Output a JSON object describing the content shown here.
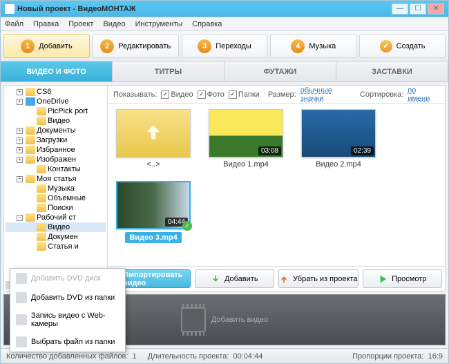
{
  "window": {
    "title": "Новый проект - ВидеоМОНТАЖ"
  },
  "menu": [
    "Файл",
    "Правка",
    "Проект",
    "Видео",
    "Инструменты",
    "Справка"
  ],
  "steps": [
    {
      "num": "1",
      "label": "Добавить"
    },
    {
      "num": "2",
      "label": "Редактировать"
    },
    {
      "num": "3",
      "label": "Переходы"
    },
    {
      "num": "4",
      "label": "Музыка"
    },
    {
      "check": "✓",
      "label": "Создать"
    }
  ],
  "tabs": [
    "ВИДЕО И ФОТО",
    "ТИТРЫ",
    "ФУТАЖИ",
    "ЗАСТАВКИ"
  ],
  "filters": {
    "show_label": "Показывать:",
    "video": "Видео",
    "photo": "Фото",
    "folders": "Папки",
    "size_label": "Размер:",
    "size_value": "обычные значки",
    "sort_label": "Сортировка:",
    "sort_value": "по имени"
  },
  "tree": [
    {
      "l": 1,
      "exp": "+",
      "ic": "folder",
      "t": "CS6"
    },
    {
      "l": 1,
      "exp": "+",
      "ic": "blue",
      "t": "OneDrive"
    },
    {
      "l": 2,
      "ic": "folder",
      "t": "PicPick port"
    },
    {
      "l": 2,
      "ic": "folder",
      "t": "Видео"
    },
    {
      "l": 1,
      "exp": "+",
      "ic": "folder",
      "t": "Документы"
    },
    {
      "l": 1,
      "exp": "+",
      "ic": "folder",
      "t": "Загрузки"
    },
    {
      "l": 1,
      "exp": "+",
      "ic": "folder",
      "t": "Избранное"
    },
    {
      "l": 1,
      "exp": "+",
      "ic": "folder",
      "t": "Изображен"
    },
    {
      "l": 2,
      "ic": "folder",
      "t": "Контакты"
    },
    {
      "l": 1,
      "exp": "+",
      "ic": "folder",
      "t": "Моя статья"
    },
    {
      "l": 2,
      "ic": "folder",
      "t": "Музыка"
    },
    {
      "l": 2,
      "ic": "folder",
      "t": "Объемные"
    },
    {
      "l": 2,
      "ic": "folder",
      "t": "Поиски"
    },
    {
      "l": 1,
      "exp": "−",
      "ic": "folder",
      "t": "Рабочий ст"
    },
    {
      "l": 2,
      "ic": "folder",
      "t": "Видео",
      "sel": true
    },
    {
      "l": 2,
      "ic": "folder",
      "t": "Докумен"
    },
    {
      "l": 2,
      "ic": "folder",
      "t": "Статья и"
    }
  ],
  "thumbs": [
    {
      "type": "up",
      "name": "<..>"
    },
    {
      "type": "vid",
      "name": "Видео 1.mp4",
      "dur": "03:08",
      "bg": "linear-gradient(#f8e85a 0%,#f8e85a 55%,#3a7a2a 55%)"
    },
    {
      "type": "vid",
      "name": "Видео 2.mp4",
      "dur": "02:39",
      "bg": "linear-gradient(#2a6aa8,#184a78)"
    },
    {
      "type": "vid",
      "name": "Видео 3.mp4",
      "dur": "04:44",
      "bg": "linear-gradient(90deg,#2a4a2a,#4a6a4a,#c8d8e8)",
      "sel": true
    }
  ],
  "actions": {
    "import": "Импортировать видео",
    "add": "Добавить",
    "remove": "Убрать из проекта",
    "preview": "Просмотр"
  },
  "popup": [
    {
      "t": "Добавить DVD диск",
      "d": true
    },
    {
      "t": "Добавить DVD из папки"
    },
    {
      "t": "Запись видео с Web-камеры"
    },
    {
      "t": "Выбрать файл из папки"
    }
  ],
  "timeline": {
    "placeholder": "Добавить видео"
  },
  "status": {
    "files_label": "Количество добавленных файлов:",
    "files_value": "1",
    "len_label": "Длительность проекта:",
    "len_value": "00:04:44",
    "aspect_label": "Пропорции проекта:",
    "aspect_value": "16:9"
  }
}
